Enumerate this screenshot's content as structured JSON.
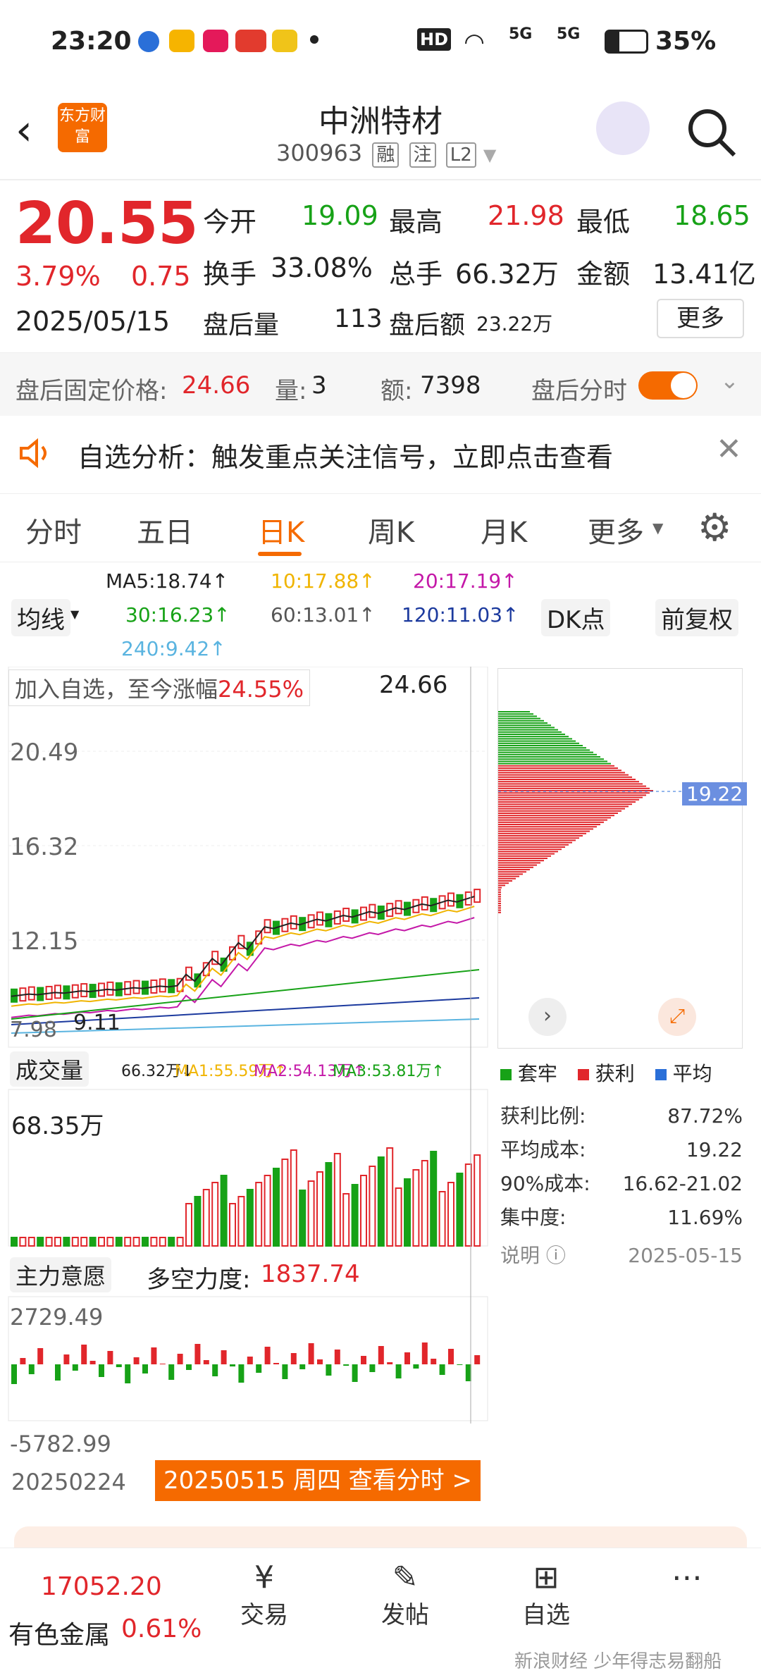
{
  "status": {
    "time": "23:20",
    "net1": "5G",
    "net2": "5G",
    "hd": "HD",
    "battery": "35%"
  },
  "header": {
    "brand": "东方财富",
    "title": "中洲特材",
    "code": "300963",
    "tag1": "融",
    "tag2": "注",
    "tag3": "L2"
  },
  "quote": {
    "price": "20.55",
    "pct": "3.79%",
    "chg": "0.75",
    "date": "2025/05/15",
    "open_label": "今开",
    "open": "19.09",
    "high_label": "最高",
    "high": "21.98",
    "low_label": "最低",
    "low": "18.65",
    "turnover_label": "换手",
    "turnover": "33.08%",
    "vol_label": "总手",
    "vol": "66.32万",
    "amt_label": "金额",
    "amt": "13.41亿",
    "after_vol_label": "盘后量",
    "after_vol": "113",
    "after_amt_label": "盘后额",
    "after_amt": "23.22万",
    "more": "更多"
  },
  "postbar": {
    "fixed_label": "盘后固定价格:",
    "fixed": "24.66",
    "qty_label": "量:",
    "qty": "3",
    "amt_label": "额:",
    "amt": "7398",
    "toggle_label": "盘后分时"
  },
  "notice": {
    "text": "自选分析：触发重点关注信号，立即点击查看"
  },
  "tabs": [
    "分时",
    "五日",
    "日K",
    "周K",
    "月K",
    "更多"
  ],
  "ma": {
    "selector": "均线",
    "ma5": "MA5:18.74↑",
    "ma10": "10:17.88↑",
    "ma20": "20:17.19↑",
    "ma30": "30:16.23↑",
    "ma60": "60:13.01↑",
    "ma120": "120:11.03↑",
    "ma240": "240:9.42↑",
    "dk": "DK点",
    "adj": "前复权"
  },
  "chart": {
    "badge_label": "加入自选，至今涨幅",
    "badge_val": "24.55%",
    "top_price": "24.66",
    "y1": "20.49",
    "y2": "16.32",
    "y3": "12.15",
    "y4": "7.98",
    "low_mark": "9.11",
    "vol_selector": "成交量",
    "vol_info": "66.32万↓",
    "vma1": "MA1:55.59万↑",
    "vma2": "MA2:54.13万↑",
    "vma3": "MA3:53.81万↑",
    "vol_max": "68.35万",
    "ind_selector": "主力意愿",
    "ind_name": "多空力度:",
    "ind_val": "1837.74",
    "ind_max": "2729.49",
    "ind_min": "-5782.99",
    "date_left": "20250224",
    "date_btn": "20250515 周四 查看分时 >"
  },
  "side": {
    "cost_price": "19.22",
    "legend": [
      "套牢",
      "获利",
      "平均"
    ],
    "rows": [
      {
        "k": "获利比例:",
        "v": "87.72%"
      },
      {
        "k": "平均成本:",
        "v": "19.22"
      },
      {
        "k": "90%成本:",
        "v": "16.62-21.02"
      },
      {
        "k": "集中度:",
        "v": "11.69%"
      }
    ],
    "note": "说明",
    "date": "2025-05-15"
  },
  "bottom": {
    "index_val": "17052.20",
    "index_name": "有色金属",
    "index_pct": "0.61%",
    "trade": "交易",
    "post": "发帖",
    "watch": "自选"
  },
  "watermark": "新浪财经 少年得志易翻船",
  "colors": {
    "red": "#e1262b",
    "green": "#17a217",
    "orange": "#f56a00"
  }
}
